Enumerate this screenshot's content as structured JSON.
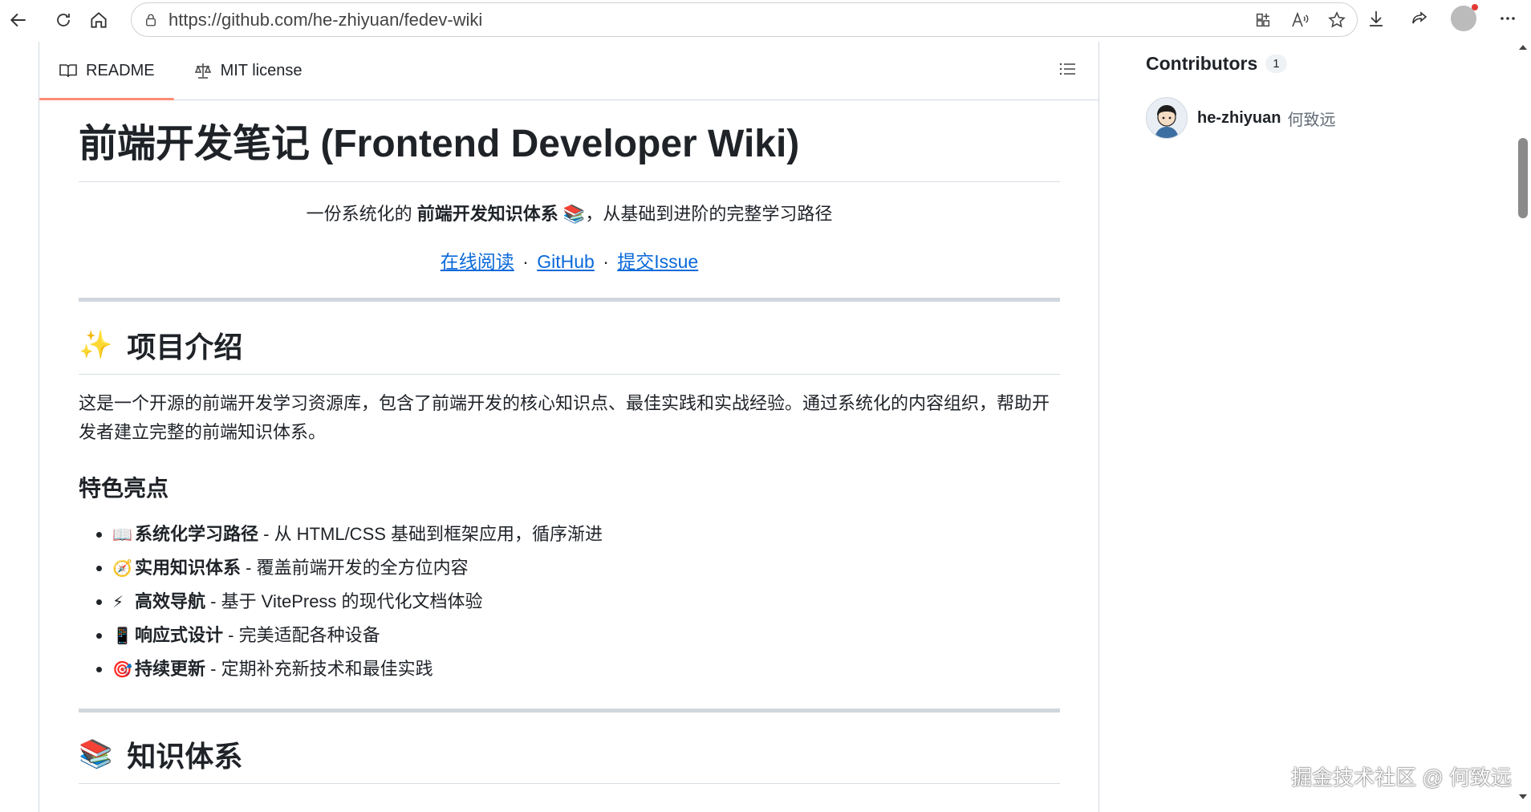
{
  "browser": {
    "url": "https://github.com/he-zhiyuan/fedev-wiki"
  },
  "tabs": [
    {
      "label": "README",
      "active": true
    },
    {
      "label": "MIT license",
      "active": false
    }
  ],
  "readme": {
    "title": "前端开发笔记 (Frontend Developer Wiki)",
    "tagline_prefix": "一份系统化的",
    "tagline_bold": "前端开发知识体系",
    "tagline_emoji": "📚",
    "tagline_suffix": "，从基础到进阶的完整学习路径",
    "links": [
      {
        "label": "在线阅读"
      },
      {
        "label": "GitHub"
      },
      {
        "label": "提交Issue"
      }
    ],
    "link_separator": "·",
    "intro_heading_emoji": "✨",
    "intro_heading": "项目介绍",
    "intro_text": "这是一个开源的前端开发学习资源库，包含了前端开发的核心知识点、最佳实践和实战经验。通过系统化的内容组织，帮助开发者建立完整的前端知识体系。",
    "features_heading": "特色亮点",
    "features": [
      {
        "emoji": "📖",
        "bold": "系统化学习路径",
        "text": " - 从 HTML/CSS 基础到框架应用，循序渐进"
      },
      {
        "emoji": "🧭",
        "bold": "实用知识体系",
        "text": " - 覆盖前端开发的全方位内容"
      },
      {
        "emoji": "⚡",
        "bold": "高效导航",
        "text": " - 基于 VitePress 的现代化文档体验"
      },
      {
        "emoji": "📱",
        "bold": "响应式设计",
        "text": " - 完美适配各种设备"
      },
      {
        "emoji": "🎯",
        "bold": "持续更新",
        "text": " - 定期补充新技术和最佳实践"
      }
    ],
    "knowledge_heading_emoji": "📚",
    "knowledge_heading": "知识体系"
  },
  "sidebar": {
    "contributors_title": "Contributors",
    "contributors_count": "1",
    "contributors": [
      {
        "username": "he-zhiyuan",
        "fullname": "何致远"
      }
    ]
  },
  "watermark": "掘金技术社区 @ 何致远",
  "colors": {
    "link": "#0969da",
    "active_tab_underline": "#fd8c73"
  }
}
